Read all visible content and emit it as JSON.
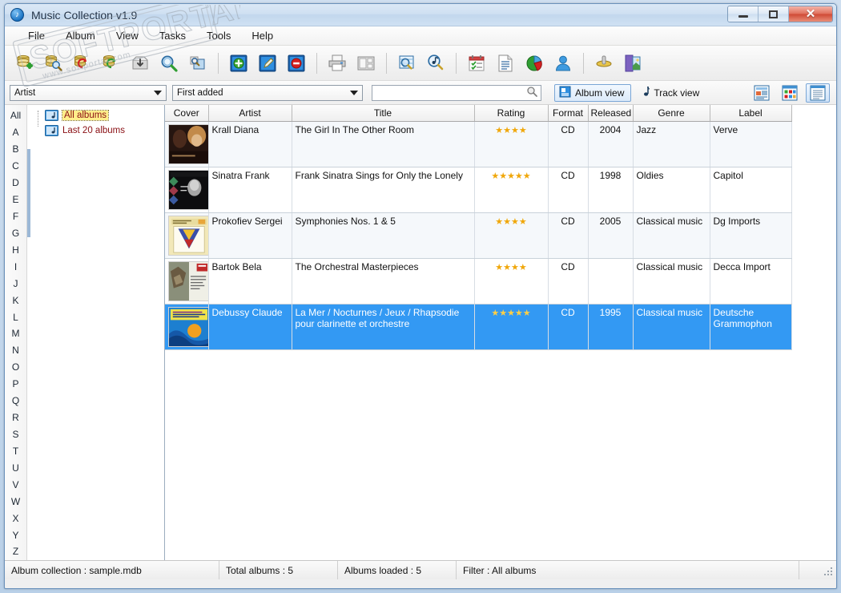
{
  "window": {
    "title": "Music Collection v1.9",
    "app_icon": "music-note-icon",
    "minimize_label": "Minimize",
    "maximize_label": "Maximize",
    "close_label": "Close"
  },
  "menu": {
    "items": [
      {
        "label": "File"
      },
      {
        "label": "Album"
      },
      {
        "label": "View"
      },
      {
        "label": "Tasks"
      },
      {
        "label": "Tools"
      },
      {
        "label": "Help"
      }
    ]
  },
  "toolbar": {
    "buttons": [
      {
        "icon": "new-collection-icon",
        "tooltip": "New collection"
      },
      {
        "icon": "open-collection-icon",
        "tooltip": "Open collection"
      },
      {
        "icon": "save-collection-icon",
        "tooltip": "Save collection"
      },
      {
        "icon": "refresh-collection-icon",
        "tooltip": "Refresh collection"
      },
      {
        "icon": "import-icon",
        "tooltip": "Import"
      },
      {
        "icon": "search-album-icon",
        "tooltip": "Search album online"
      },
      {
        "icon": "preview-icon",
        "tooltip": "Preview"
      },
      {
        "sep": true
      },
      {
        "icon": "add-album-icon",
        "tooltip": "Add album"
      },
      {
        "icon": "edit-album-icon",
        "tooltip": "Edit album"
      },
      {
        "icon": "delete-album-icon",
        "tooltip": "Delete album"
      },
      {
        "sep": true
      },
      {
        "icon": "print-icon",
        "tooltip": "Print"
      },
      {
        "icon": "labels-icon",
        "tooltip": "Print labels"
      },
      {
        "sep": true
      },
      {
        "icon": "browse-icon",
        "tooltip": "Browse collection"
      },
      {
        "icon": "find-track-icon",
        "tooltip": "Find track"
      },
      {
        "sep": true
      },
      {
        "icon": "loan-list-icon",
        "tooltip": "Loan list"
      },
      {
        "icon": "report-icon",
        "tooltip": "Reports"
      },
      {
        "icon": "statistics-icon",
        "tooltip": "Statistics"
      },
      {
        "icon": "contacts-icon",
        "tooltip": "Contacts"
      },
      {
        "sep": true
      },
      {
        "icon": "options-icon",
        "tooltip": "Options"
      },
      {
        "icon": "exit-icon",
        "tooltip": "Exit"
      }
    ]
  },
  "filterbar": {
    "group_combo": {
      "value": "Artist",
      "options": [
        "Artist",
        "Title",
        "Genre",
        "Label",
        "Released"
      ]
    },
    "sort_combo": {
      "value": "First added",
      "options": [
        "First added",
        "Artist",
        "Title",
        "Rating",
        "Released"
      ]
    },
    "search": {
      "value": "",
      "placeholder": "",
      "icon": "search-icon"
    },
    "album_view": {
      "label": "Album view",
      "icon": "album-view-icon",
      "active": true
    },
    "track_view": {
      "label": "Track view",
      "icon": "music-note-icon",
      "active": false
    },
    "layouts": [
      {
        "name": "details-layout",
        "label": "Details view",
        "active": false
      },
      {
        "name": "thumbnails-layout",
        "label": "Thumbnails view",
        "active": false
      },
      {
        "name": "list-layout",
        "label": "List view",
        "active": true
      }
    ]
  },
  "sidebar": {
    "alphabet": [
      "All",
      "A",
      "B",
      "C",
      "D",
      "E",
      "F",
      "G",
      "H",
      "I",
      "J",
      "K",
      "L",
      "M",
      "N",
      "O",
      "P",
      "Q",
      "R",
      "S",
      "T",
      "U",
      "V",
      "W",
      "X",
      "Y",
      "Z"
    ],
    "tree": [
      {
        "label": "All albums",
        "icon": "album-folder-icon",
        "selected": true
      },
      {
        "label": "Last 20 albums",
        "icon": "album-folder-icon",
        "selected": false
      }
    ]
  },
  "grid": {
    "columns": [
      {
        "key": "cover",
        "label": "Cover"
      },
      {
        "key": "artist",
        "label": "Artist"
      },
      {
        "key": "title",
        "label": "Title"
      },
      {
        "key": "rating",
        "label": "Rating"
      },
      {
        "key": "format",
        "label": "Format"
      },
      {
        "key": "released",
        "label": "Released"
      },
      {
        "key": "genre",
        "label": "Genre"
      },
      {
        "key": "label",
        "label": "Label"
      }
    ],
    "rows": [
      {
        "artist": "Krall Diana",
        "title": "The Girl In The Other Room",
        "rating": 4,
        "format": "CD",
        "released": "2004",
        "genre": "Jazz",
        "label": "Verve",
        "cover": "krall-diana-cover",
        "selected": false
      },
      {
        "artist": "Sinatra Frank",
        "title": "Frank Sinatra Sings for Only the Lonely",
        "rating": 5,
        "format": "CD",
        "released": "1998",
        "genre": "Oldies",
        "label": "Capitol",
        "cover": "sinatra-frank-cover",
        "selected": false
      },
      {
        "artist": "Prokofiev Sergei",
        "title": "Symphonies Nos. 1 & 5",
        "rating": 4,
        "format": "CD",
        "released": "2005",
        "genre": "Classical music",
        "label": "Dg Imports",
        "cover": "prokofiev-cover",
        "selected": false
      },
      {
        "artist": "Bartok Bela",
        "title": "The Orchestral Masterpieces",
        "rating": 4,
        "format": "CD",
        "released": "",
        "genre": "Classical music",
        "label": "Decca Import",
        "cover": "bartok-cover",
        "selected": false
      },
      {
        "artist": "Debussy Claude",
        "title": "La Mer / Nocturnes / Jeux / Rhapsodie pour clarinette et orchestre",
        "rating": 5,
        "format": "CD",
        "released": "1995",
        "genre": "Classical music",
        "label": "Deutsche Grammophon",
        "cover": "debussy-cover",
        "selected": true
      }
    ]
  },
  "statusbar": {
    "collection": "Album collection : sample.mdb",
    "total": "Total albums : 5",
    "loaded": "Albums loaded : 5",
    "filter": "Filter : All albums"
  },
  "watermark": {
    "line1": "SOFTPORTAL",
    "line2": "www.softportal.com"
  },
  "colors": {
    "selection": "#3399f3",
    "star": "#f0a70a",
    "tree_text": "#8a0f14",
    "tree_highlight": "#ffee8a",
    "titlebar": "#c2d7ed",
    "close_button": "#cf4a35"
  }
}
